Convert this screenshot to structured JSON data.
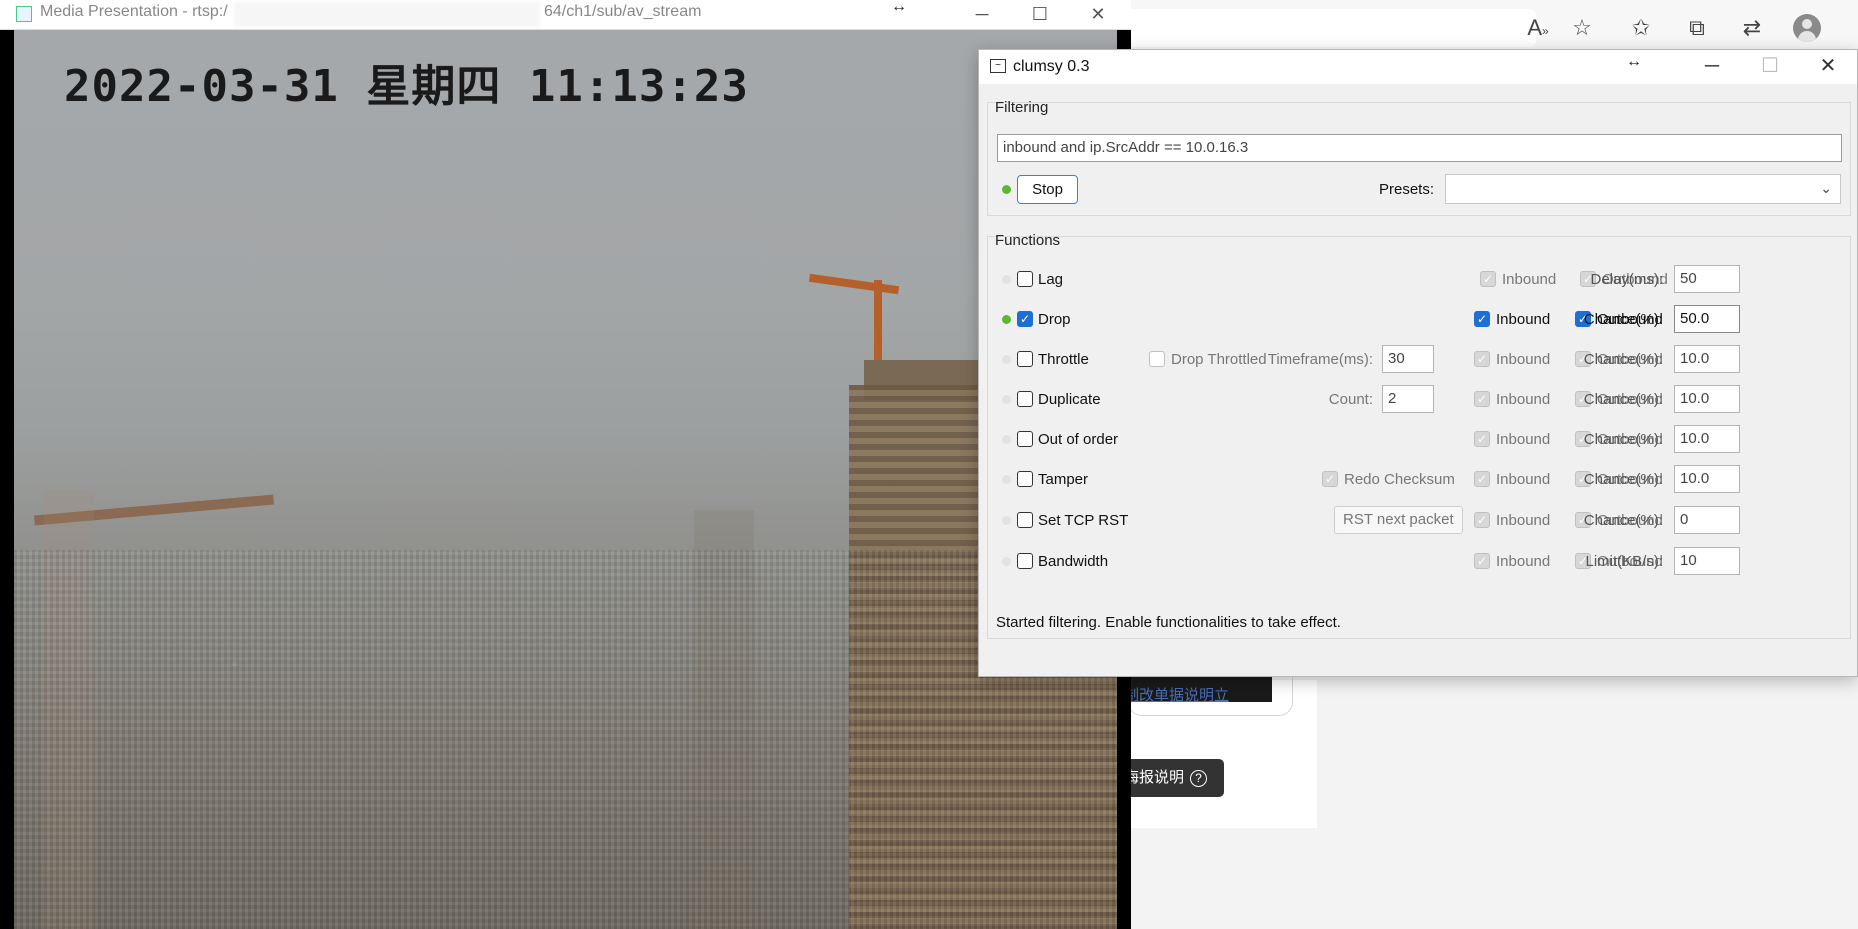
{
  "browser": {
    "icons": [
      "read-aloud-icon",
      "favorite-add-icon",
      "favorites-icon",
      "collections-icon",
      "extensions-icon",
      "profile-icon"
    ],
    "link_text": "制改单据说明立",
    "button_label": "海报说明"
  },
  "media_window": {
    "title_prefix": "Media Presentation - rtsp:/",
    "title_suffix": "64/ch1/sub/av_stream",
    "timestamp": "2022-03-31 星期四 11:13:23"
  },
  "clumsy": {
    "title": "clumsy 0.3",
    "filtering_label": "Filtering",
    "filter_text": "inbound and ip.SrcAddr == 10.0.16.3",
    "stop_label": "Stop",
    "presets_label": "Presets:",
    "presets_value": "",
    "functions_label": "Functions",
    "status_text": "Started filtering. Enable functionalities to take effect.",
    "functions": [
      {
        "name": "Lag",
        "enabled": false,
        "inbound": true,
        "outbound": true,
        "param_label": "Delay(ms):",
        "param_value": "50"
      },
      {
        "name": "Drop",
        "enabled": true,
        "inbound": true,
        "outbound": true,
        "param_label": "Chance(%):",
        "param_value": "50.0"
      },
      {
        "name": "Throttle",
        "enabled": false,
        "inbound": true,
        "outbound": true,
        "extra_check": "Drop Throttled",
        "extra_label": "Timeframe(ms):",
        "extra_value": "30",
        "param_label": "Chance(%):",
        "param_value": "10.0"
      },
      {
        "name": "Duplicate",
        "enabled": false,
        "inbound": true,
        "outbound": true,
        "extra_label": "Count:",
        "extra_value": "2",
        "param_label": "Chance(%):",
        "param_value": "10.0"
      },
      {
        "name": "Out of order",
        "enabled": false,
        "inbound": true,
        "outbound": true,
        "param_label": "Chance(%):",
        "param_value": "10.0"
      },
      {
        "name": "Tamper",
        "enabled": false,
        "inbound": true,
        "outbound": true,
        "extra_check": "Redo Checksum",
        "param_label": "Chance(%):",
        "param_value": "10.0"
      },
      {
        "name": "Set TCP RST",
        "enabled": false,
        "inbound": true,
        "outbound": true,
        "extra_button": "RST next packet",
        "param_label": "Chance(%):",
        "param_value": "0"
      },
      {
        "name": "Bandwidth",
        "enabled": false,
        "inbound": true,
        "outbound": true,
        "param_label": "Limit(KB/s):",
        "param_value": "10"
      }
    ],
    "inbound_label": "Inbound",
    "outbound_label": "Outbound"
  }
}
